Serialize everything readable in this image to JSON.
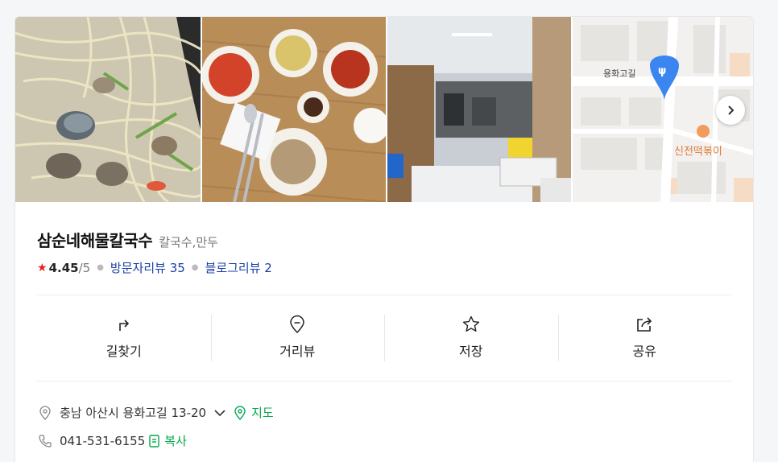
{
  "photos": [
    {
      "name": "clam-noodle-photo"
    },
    {
      "name": "side-dishes-photo"
    },
    {
      "name": "kitchen-photo"
    },
    {
      "name": "map-thumbnail"
    }
  ],
  "map": {
    "street_label": "용화고길",
    "poi_label": "신전떡볶이"
  },
  "place": {
    "name": "삼순네해물칼국수",
    "category": "칼국수,만두",
    "rating": "4.45",
    "rating_max": "/5",
    "visitor_reviews": "방문자리뷰 35",
    "blog_reviews": "블로그리뷰 2"
  },
  "actions": [
    {
      "label": "길찾기",
      "icon": "directions-icon"
    },
    {
      "label": "거리뷰",
      "icon": "street-view-icon"
    },
    {
      "label": "저장",
      "icon": "star-icon"
    },
    {
      "label": "공유",
      "icon": "share-icon"
    }
  ],
  "details": {
    "address": "충남 아산시 용화고길 13-20",
    "map_link": "지도",
    "phone": "041-531-6155",
    "copy_label": "복사"
  },
  "colors": {
    "rating_star": "#e8231f",
    "link_blue": "#1a3ea8",
    "accent_green": "#03a94d",
    "map_pin": "#3a85f0"
  }
}
